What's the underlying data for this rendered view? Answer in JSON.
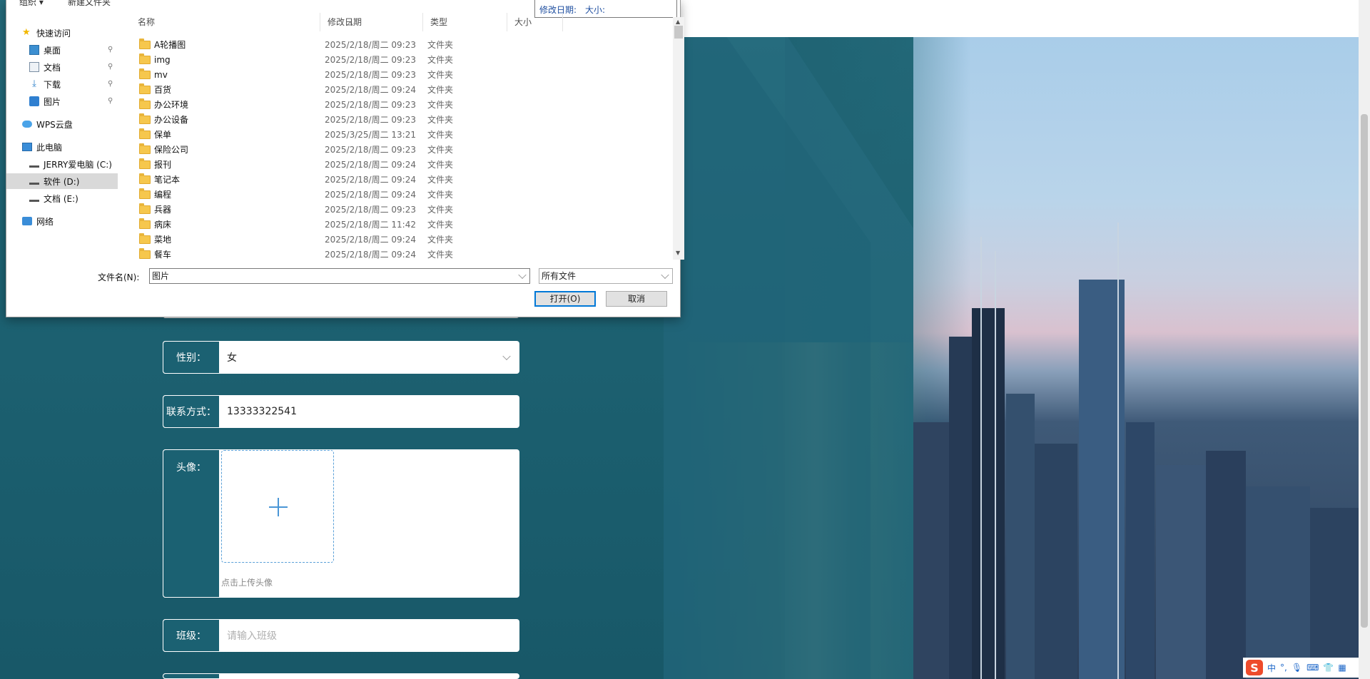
{
  "dialog": {
    "toolbar": {
      "organize": "组织 ▾",
      "new_folder": "新建文件夹"
    },
    "preview": {
      "modified_label": "修改日期:",
      "size_label": "大小:"
    },
    "nav": [
      {
        "label": "快速访问",
        "icon": "star-icon"
      },
      {
        "label": "桌面",
        "icon": "desktop-icon",
        "pinned": true
      },
      {
        "label": "文档",
        "icon": "document-icon",
        "pinned": true
      },
      {
        "label": "下载",
        "icon": "download-icon",
        "pinned": true
      },
      {
        "label": "图片",
        "icon": "pictures-icon",
        "pinned": true
      },
      {
        "label": "WPS云盘",
        "icon": "cloud-icon"
      },
      {
        "label": "此电脑",
        "icon": "computer-icon"
      },
      {
        "label": "JERRY爱电脑 (C:)",
        "icon": "drive-icon"
      },
      {
        "label": "软件 (D:)",
        "icon": "drive-icon",
        "selected": true
      },
      {
        "label": "文档 (E:)",
        "icon": "drive-icon"
      },
      {
        "label": "网络",
        "icon": "network-icon"
      }
    ],
    "columns": {
      "name": "名称",
      "modified": "修改日期",
      "type": "类型",
      "size": "大小"
    },
    "files": [
      {
        "name": "A轮播图",
        "date": "2025/2/18/周二 09:23",
        "type": "文件夹"
      },
      {
        "name": "img",
        "date": "2025/2/18/周二 09:23",
        "type": "文件夹"
      },
      {
        "name": "mv",
        "date": "2025/2/18/周二 09:23",
        "type": "文件夹"
      },
      {
        "name": "百货",
        "date": "2025/2/18/周二 09:24",
        "type": "文件夹"
      },
      {
        "name": "办公环境",
        "date": "2025/2/18/周二 09:23",
        "type": "文件夹"
      },
      {
        "name": "办公设备",
        "date": "2025/2/18/周二 09:23",
        "type": "文件夹"
      },
      {
        "name": "保单",
        "date": "2025/3/25/周二 13:21",
        "type": "文件夹"
      },
      {
        "name": "保险公司",
        "date": "2025/2/18/周二 09:23",
        "type": "文件夹"
      },
      {
        "name": "报刊",
        "date": "2025/2/18/周二 09:24",
        "type": "文件夹"
      },
      {
        "name": "笔记本",
        "date": "2025/2/18/周二 09:24",
        "type": "文件夹"
      },
      {
        "name": "编程",
        "date": "2025/2/18/周二 09:24",
        "type": "文件夹"
      },
      {
        "name": "兵器",
        "date": "2025/2/18/周二 09:23",
        "type": "文件夹"
      },
      {
        "name": "病床",
        "date": "2025/2/18/周二 11:42",
        "type": "文件夹"
      },
      {
        "name": "菜地",
        "date": "2025/2/18/周二 09:24",
        "type": "文件夹"
      },
      {
        "name": "餐车",
        "date": "2025/2/18/周二 09:24",
        "type": "文件夹"
      }
    ],
    "filename_label": "文件名(N):",
    "filename_value": "图片",
    "filter_value": "所有文件",
    "open_button": "打开(O)",
    "cancel_button": "取消"
  },
  "form": {
    "gender": {
      "label": "性别：",
      "value": "女"
    },
    "contact": {
      "label": "联系方式：",
      "value": "13333322541"
    },
    "avatar": {
      "label": "头像：",
      "hint": "点击上传头像"
    },
    "class": {
      "label": "班级：",
      "placeholder": "请输入班级"
    }
  },
  "tray": {
    "ime_lang": "中",
    "ime_punct": "°,",
    "ime_logo": "S"
  },
  "colors": {
    "accent_teal": "#1b6172",
    "dialog_primary_border": "#0078d7",
    "folder_yellow": "#f6c74d"
  }
}
